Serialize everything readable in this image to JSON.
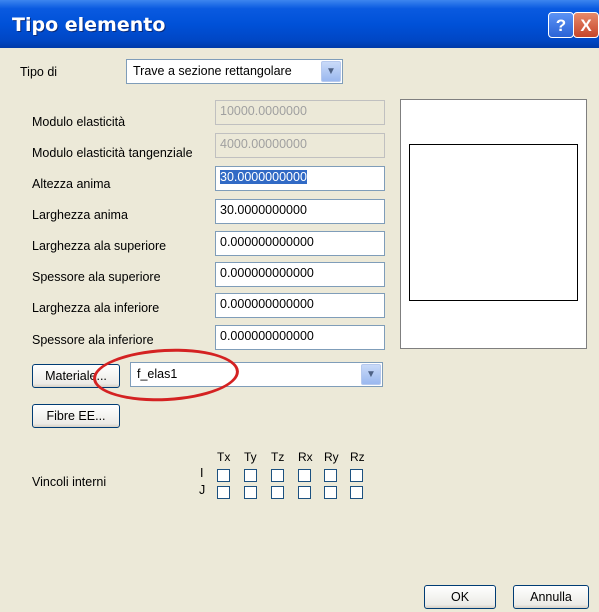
{
  "window": {
    "title": "Tipo elemento",
    "help_label": "?",
    "close_label": "X"
  },
  "tipo": {
    "label": "Tipo di",
    "value": "Trave a sezione rettangolare"
  },
  "fields": [
    {
      "label": "Modulo elasticità",
      "value": "10000.0000000",
      "disabled": true
    },
    {
      "label": "Modulo elasticità tangenziale",
      "value": "4000.00000000",
      "disabled": true
    },
    {
      "label": "Altezza anima",
      "value": "30.0000000000",
      "disabled": false
    },
    {
      "label": "Larghezza anima",
      "value": "30.0000000000",
      "disabled": false
    },
    {
      "label": "Larghezza ala superiore",
      "value": "0.000000000000",
      "disabled": false
    },
    {
      "label": "Spessore ala superiore",
      "value": "0.000000000000",
      "disabled": false
    },
    {
      "label": "Larghezza ala inferiore",
      "value": "0.000000000000",
      "disabled": false
    },
    {
      "label": "Spessore ala inferiore",
      "value": "0.000000000000",
      "disabled": false
    }
  ],
  "materiale": {
    "button_label": "Materiale...",
    "value": "f_elas1"
  },
  "fibre": {
    "button_label": "Fibre EE..."
  },
  "vincoli": {
    "label": "Vincoli interni",
    "columns": [
      "Tx",
      "Ty",
      "Tz",
      "Rx",
      "Ry",
      "Rz"
    ],
    "rows": [
      "I",
      "J"
    ]
  },
  "buttons": {
    "ok": "OK",
    "cancel": "Annulla"
  },
  "colors": {
    "title_bar": "#0051d8",
    "dialog_bg": "#ece9d8",
    "selection": "#316ac5",
    "annotation": "#d42222"
  }
}
